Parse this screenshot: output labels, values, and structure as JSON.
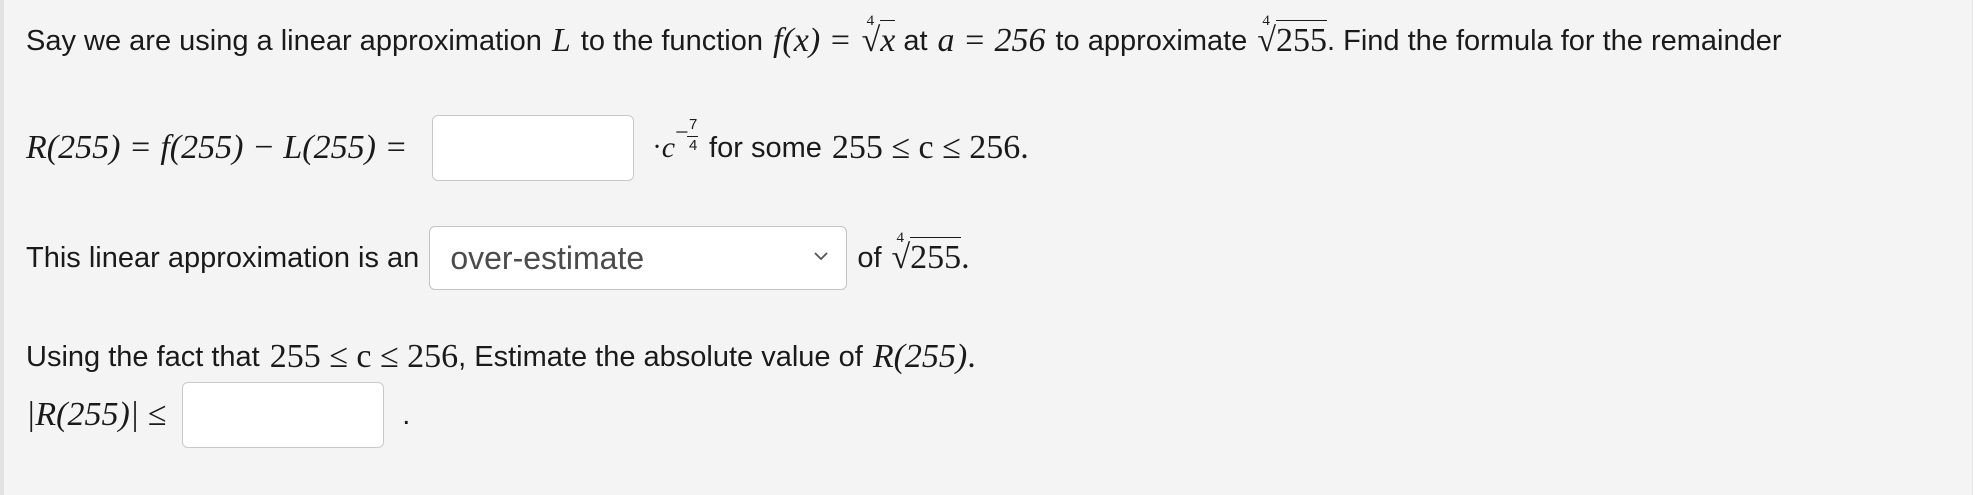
{
  "line1": {
    "text_a": "Say we are using a linear approximation",
    "L": "L",
    "text_b": "to the function",
    "fx": "f(x) =",
    "root_index": "4",
    "root_var": "x",
    "text_c": "at",
    "a_eq": "a = 256",
    "text_d": "to approximate",
    "root_value": "255",
    "text_e": ". Find the formula for the remainder"
  },
  "line2": {
    "lhs": "R(255) = f(255) − L(255) =",
    "answer_value": "",
    "dot": "·",
    "c_var": "c",
    "exp_minus": "−",
    "exp_num": "7",
    "exp_den": "4",
    "text_for": "for some",
    "range": "255 ≤ c ≤ 256",
    "period": "."
  },
  "line3": {
    "text_a": "This linear approximation is an",
    "select_value": "over-estimate",
    "text_of": "of",
    "root_index": "4",
    "root_value": "255",
    "period": "."
  },
  "line4": {
    "text_a": "Using the fact that",
    "range": "255 ≤ c ≤ 256",
    "text_b": ", Estimate the absolute value of",
    "R": "R(255)",
    "period": "."
  },
  "line5": {
    "lhs": "|R(255)| ≤",
    "answer_value": "",
    "period": "."
  }
}
